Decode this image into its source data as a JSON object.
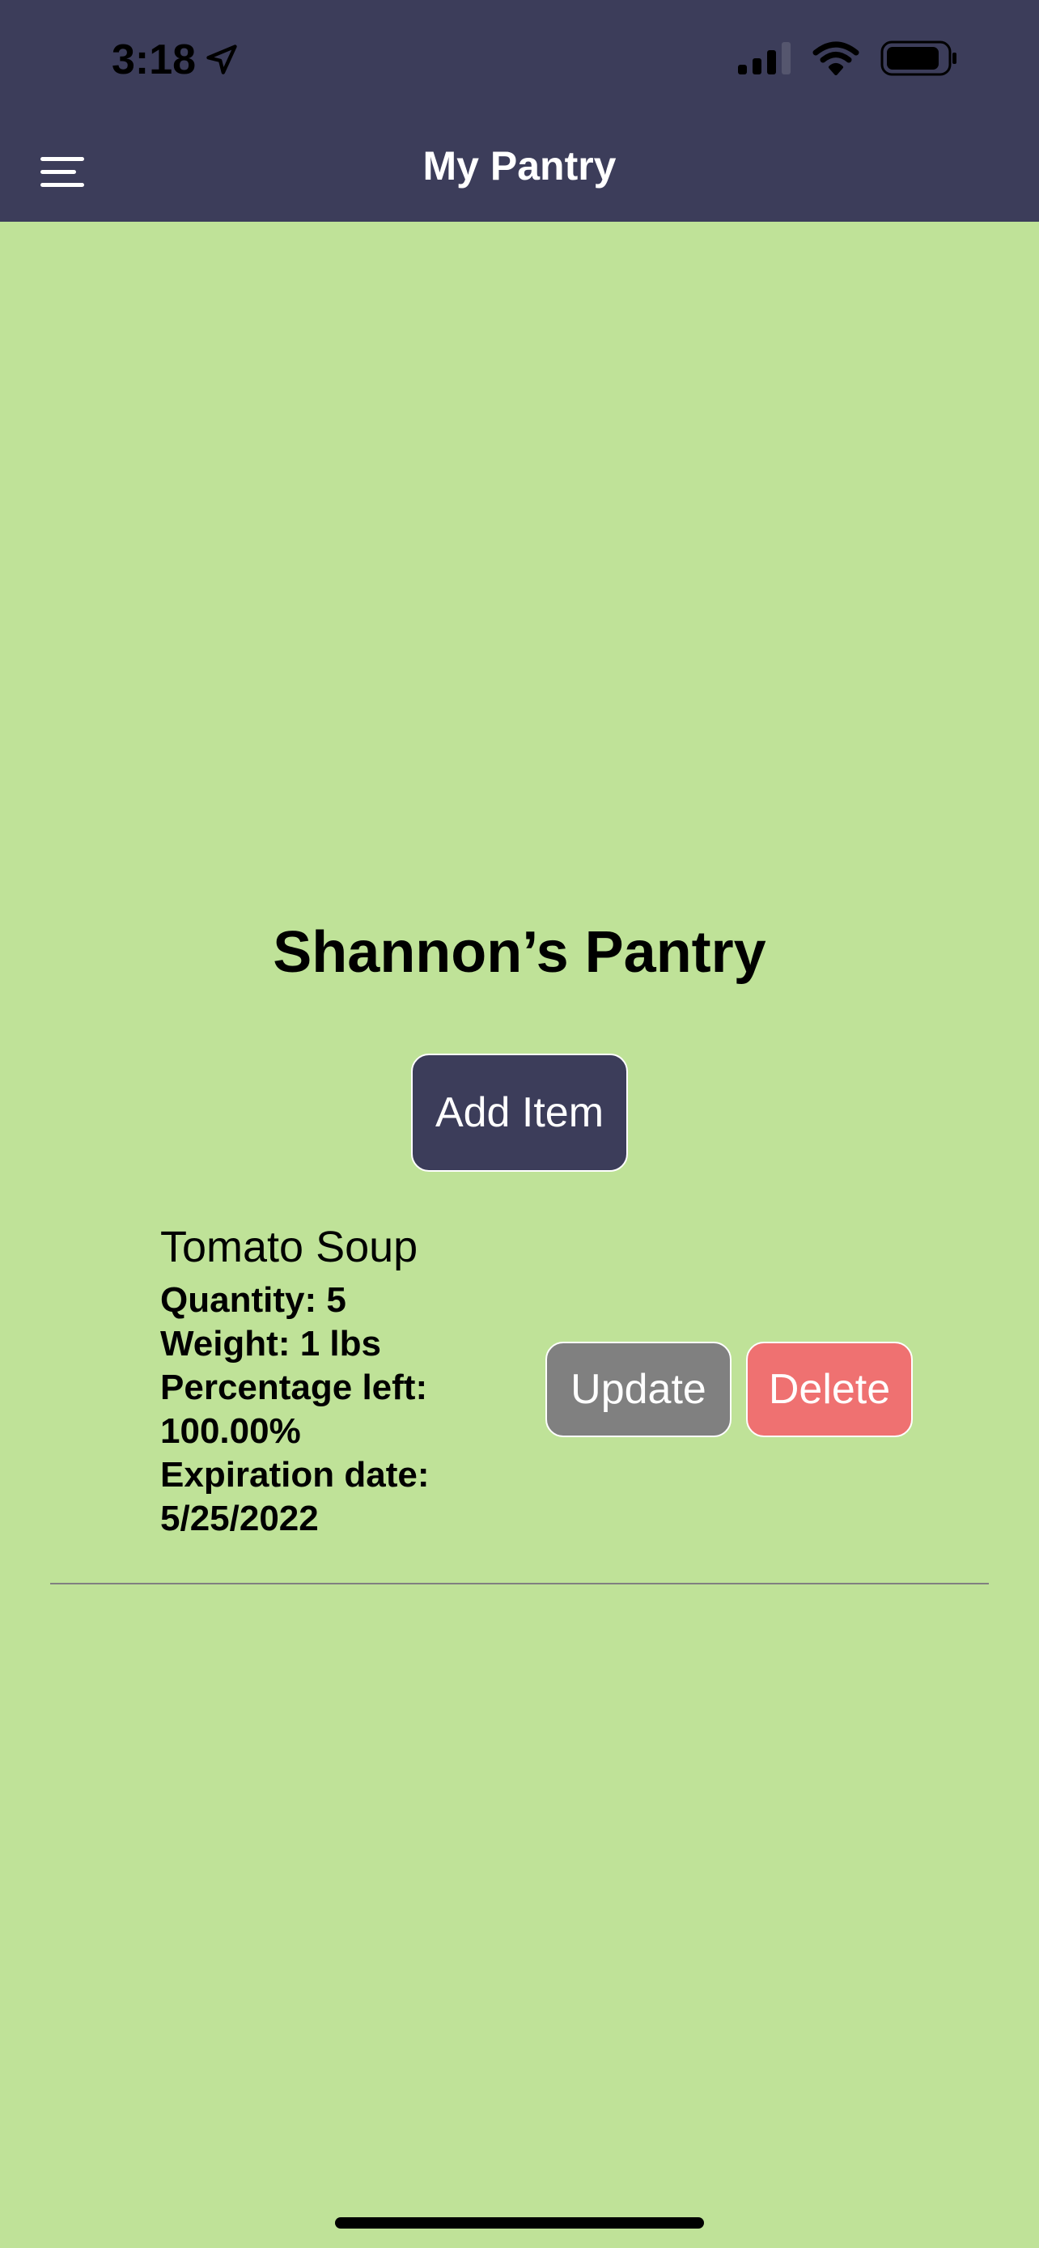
{
  "status_bar": {
    "time": "3:18",
    "icons": [
      "location-arrow-icon",
      "cellular-signal-icon",
      "wifi-icon",
      "battery-icon"
    ]
  },
  "nav": {
    "title": "My Pantry",
    "menu_icon": "hamburger-menu-icon"
  },
  "pantry": {
    "title": "Shannon’s Pantry",
    "add_button": "Add Item"
  },
  "items": [
    {
      "name": "Tomato Soup",
      "lines": [
        "Quantity: 5",
        "Weight: 1 lbs",
        "Percentage left:",
        "100.00%",
        "Expiration date:",
        "5/25/2022"
      ],
      "update_label": "Update",
      "delete_label": "Delete"
    }
  ],
  "colors": {
    "header": "#3c3d5a",
    "background": "#bfe298",
    "update": "#808080",
    "delete": "#ef7171"
  }
}
